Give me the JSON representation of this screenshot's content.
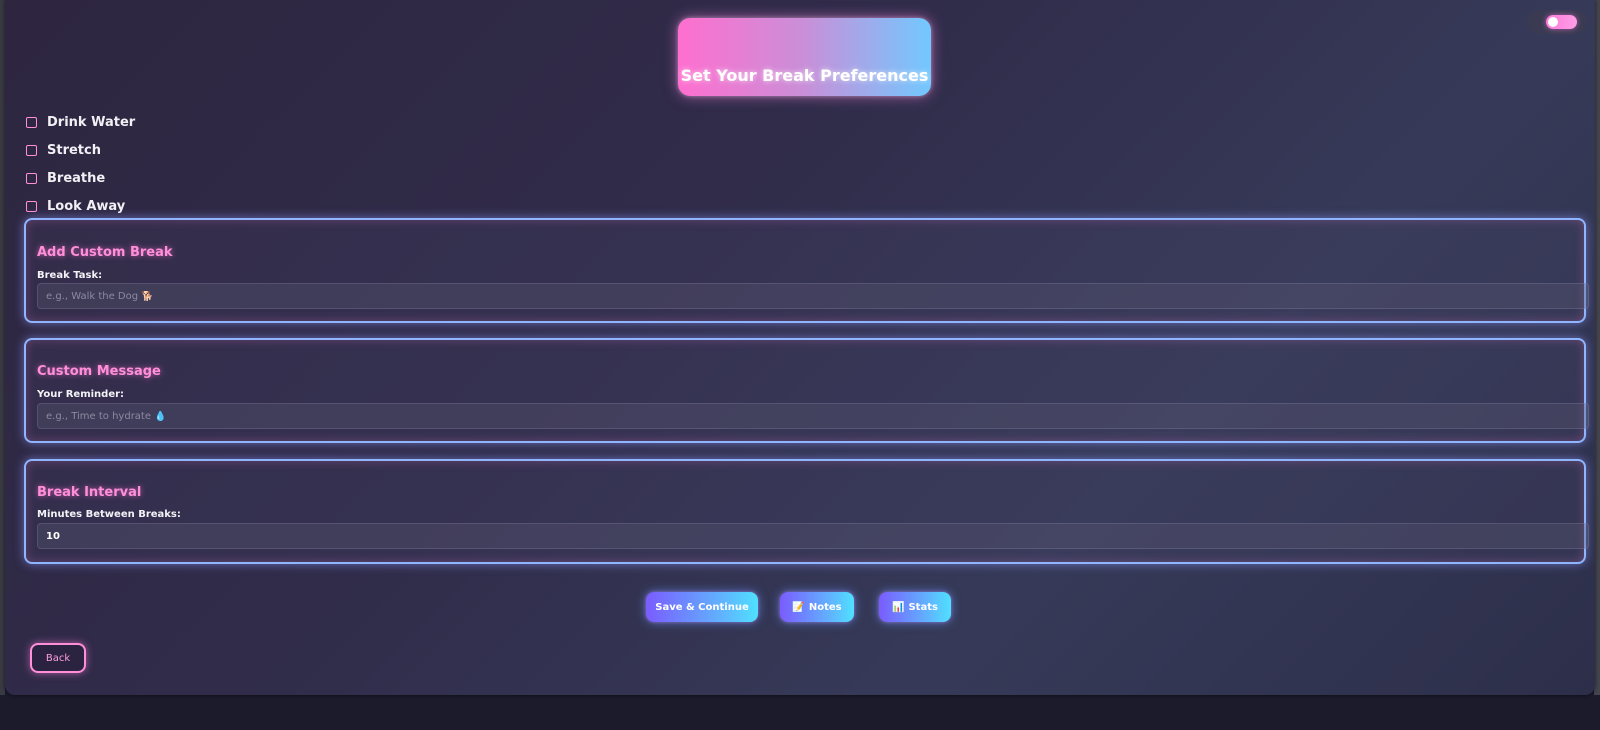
{
  "header": {
    "title": "Set Your Break Preferences"
  },
  "theme_toggle": {
    "state": "on",
    "accent": "#ff7ad9"
  },
  "preset_breaks": [
    {
      "label": "Drink Water",
      "checked": false
    },
    {
      "label": "Stretch",
      "checked": false
    },
    {
      "label": "Breathe",
      "checked": false
    },
    {
      "label": "Look Away",
      "checked": false
    }
  ],
  "custom_break": {
    "title": "Add Custom Break",
    "label": "Break Task:",
    "placeholder": "e.g., Walk the Dog 🐕",
    "value": ""
  },
  "custom_message": {
    "title": "Custom Message",
    "label": "Your Reminder:",
    "placeholder": "e.g., Time to hydrate 💧",
    "value": ""
  },
  "break_interval": {
    "title": "Break Interval",
    "label": "Minutes Between Breaks:",
    "value": "10"
  },
  "actions": {
    "save_label": "Save & Continue",
    "notes_label": "Notes",
    "notes_icon": "📝",
    "stats_label": "Stats",
    "stats_icon": "📊",
    "back_label": "Back"
  },
  "colors": {
    "accent_pink": "#ff8fd9",
    "accent_blue": "#72c8ff",
    "panel_border": "#8fb5ff"
  }
}
